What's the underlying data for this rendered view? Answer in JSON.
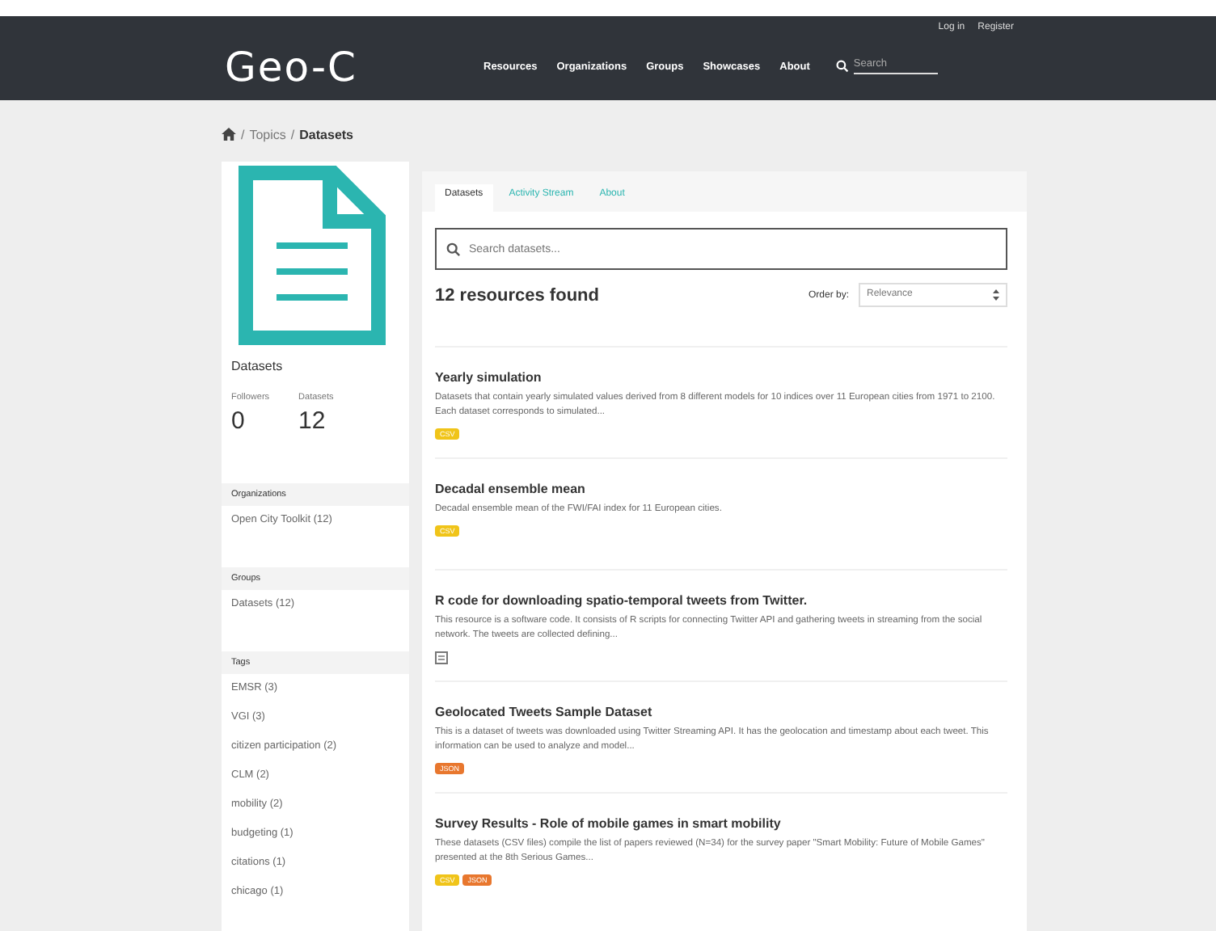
{
  "header": {
    "account_links": [
      "Log in",
      "Register"
    ],
    "logo": "Geo-C",
    "nav": [
      "Resources",
      "Organizations",
      "Groups",
      "Showcases",
      "About"
    ],
    "search": {
      "placeholder": "Search"
    }
  },
  "breadcrumb": {
    "separator": "/",
    "items": [
      "Topics",
      "Datasets"
    ]
  },
  "sidebar": {
    "title": "Datasets",
    "stats": [
      {
        "label": "Followers",
        "value": "0"
      },
      {
        "label": "Datasets",
        "value": "12"
      }
    ],
    "sections": [
      {
        "heading": "Organizations",
        "items": [
          "Open City Toolkit (12)"
        ]
      },
      {
        "heading": "Groups",
        "items": [
          "Datasets (12)"
        ]
      },
      {
        "heading": "Tags",
        "items": [
          "EMSR (3)",
          "VGI (3)",
          "citizen participation (2)",
          "CLM (2)",
          "mobility (2)",
          "budgeting (1)",
          "citations (1)",
          "chicago (1)"
        ]
      }
    ]
  },
  "tabs": [
    {
      "label": "Datasets",
      "selected": true
    },
    {
      "label": "Activity Stream",
      "selected": false
    },
    {
      "label": "About",
      "selected": false
    }
  ],
  "search": {
    "placeholder": "Search datasets..."
  },
  "results": {
    "count": "12 resources found",
    "order_label": "Order by:",
    "order_value": "Relevance"
  },
  "datasets": [
    {
      "title": "Yearly simulation",
      "description": "Datasets that contain yearly simulated values derived from 8 different models for 10 indices over 11 European cities from 1971 to 2100. Each dataset corresponds to simulated...",
      "formats": [
        {
          "label": "CSV",
          "color": "#f0c419"
        }
      ]
    },
    {
      "title": "Decadal ensemble mean",
      "description": "Decadal ensemble mean of the FWI/FAI index for 11 European cities.",
      "formats": [
        {
          "label": "CSV",
          "color": "#f0c419"
        }
      ]
    },
    {
      "title": "R code for downloading spatio-temporal tweets from Twitter.",
      "description": "This resource is a software code. It consists of R scripts for connecting Twitter API and gathering tweets in streaming from the social network. The tweets are collected defining..."
    },
    {
      "title": "Geolocated Tweets Sample Dataset",
      "description": "This is a dataset of tweets was downloaded using Twitter Streaming API. It has the geolocation and timestamp about each tweet. This information can be used to analyze and model...",
      "formats": [
        {
          "label": "JSON",
          "color": "#e8772e"
        }
      ]
    },
    {
      "title": "Survey Results - Role of mobile games in smart mobility",
      "description": "These datasets (CSV files) compile the list of papers reviewed (N=34) for the survey paper \"Smart Mobility: Future of Mobile Games\" presented at the 8th Serious Games...",
      "formats": [
        {
          "label": "CSV",
          "color": "#f0c419"
        },
        {
          "label": "JSON",
          "color": "#e8772e"
        }
      ]
    }
  ]
}
